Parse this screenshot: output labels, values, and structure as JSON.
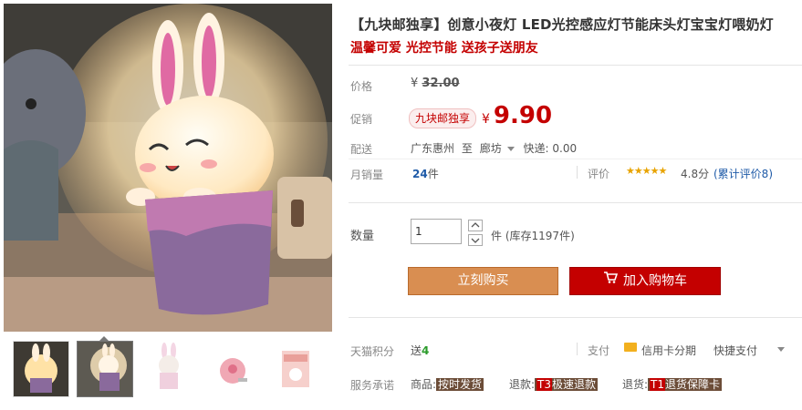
{
  "product": {
    "title": "【九块邮独享】创意小夜灯 LED光控感应灯节能床头灯宝宝灯喂奶灯",
    "subtitle": "温馨可爱 光控节能 送孩子送朋友"
  },
  "price": {
    "label": "价格",
    "currency": "¥",
    "original": "32.00"
  },
  "promo": {
    "label": "促销",
    "tag": "九块邮独享",
    "currency": "¥",
    "price": "9.90"
  },
  "shipping": {
    "label": "配送",
    "from": "广东惠州",
    "to_word": "至",
    "destination": "廊坊",
    "method": "快递: 0.00"
  },
  "sales": {
    "label": "月销量",
    "count": "24",
    "unit": "件"
  },
  "rating": {
    "label": "评价",
    "stars": "★★★★★",
    "score": "4.8分",
    "reviews": "(累计评价8)",
    "value": 4.8
  },
  "quantity": {
    "label": "数量",
    "value": "1",
    "stock_unit": "件",
    "stock": "(库存1197件)"
  },
  "buttons": {
    "buy_now": "立刻购买",
    "add_cart": "加入购物车"
  },
  "points": {
    "label": "天猫积分",
    "prefix": "送",
    "value": "4"
  },
  "payment": {
    "label": "支付",
    "card": "信用卡分期",
    "quick": "快捷支付"
  },
  "service": {
    "label": "服务承诺",
    "items": [
      {
        "prefix": "商品:",
        "tag": "按时发货"
      },
      {
        "prefix": "退款:",
        "abbr": "T3",
        "tag": "极速退款"
      },
      {
        "prefix": "退货:",
        "abbr": "T1",
        "tag": "退货保障卡"
      }
    ]
  },
  "colors": {
    "accent_red": "#c40000",
    "buy_orange": "#d98e51",
    "link_blue": "#1f5ba8",
    "star_gold": "#e8a300",
    "tag_brown": "#6c4d38"
  },
  "thumbnails": [
    "product-photo-front",
    "product-photo-glow",
    "product-photo-white",
    "product-photo-side-plug",
    "product-photo-box"
  ]
}
